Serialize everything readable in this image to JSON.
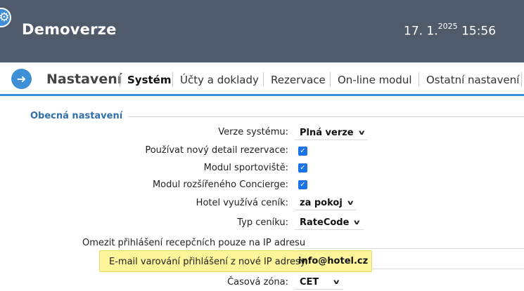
{
  "header": {
    "app_title": "Demoverze",
    "date": "17. 1.",
    "year": "2025",
    "time": "15:56",
    "gear_icon": "gear-icon"
  },
  "nav": {
    "title": "Nastavení",
    "arrow_icon": "arrow-right-icon",
    "tabs": [
      {
        "label": "Systém",
        "active": true
      },
      {
        "label": "Účty a doklady",
        "active": false
      },
      {
        "label": "Rezervace",
        "active": false
      },
      {
        "label": "On-line modul",
        "active": false
      },
      {
        "label": "Ostatní nastavení",
        "active": false
      }
    ]
  },
  "section": {
    "title": "Obecná nastavení"
  },
  "settings": {
    "system_version": {
      "label": "Verze systému:",
      "value": "Plná verze"
    },
    "new_reservation_detail": {
      "label": "Používat nový detail rezervace:",
      "checked": true
    },
    "sports_module": {
      "label": "Modul sportoviště:",
      "checked": true
    },
    "concierge_module": {
      "label": "Modul rozšířeného Concierge:",
      "checked": true
    },
    "price_list_usage": {
      "label": "Hotel využívá ceník:",
      "value": "za pokoj"
    },
    "price_list_type": {
      "label": "Typ ceníku:",
      "value": "RateCode"
    },
    "ip_restriction": {
      "label": "Omezit přihlášení recepčních pouze na IP adresu",
      "value": ""
    },
    "ip_warning_email": {
      "label": "E-mail varování přihlášení z nové IP adresy:",
      "value": "info@hotel.cz"
    },
    "timezone": {
      "label": "Časová zóna:",
      "value": "CET"
    }
  },
  "colors": {
    "header_bg": "#4f5b6b",
    "accent": "#3f8fd6",
    "section_title": "#2f6fab",
    "highlight": "#fdf59a",
    "checkbox": "#1a73e8"
  }
}
